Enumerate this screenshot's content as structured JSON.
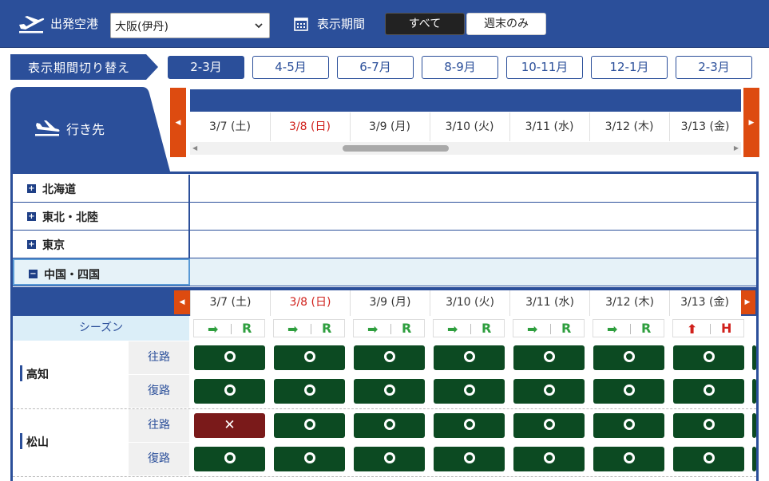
{
  "header": {
    "airport_label": "出発空港",
    "airport_value": "大阪(伊丹)",
    "period_label": "表示期間",
    "toggle_all": "すべて",
    "toggle_weekend": "週末のみ"
  },
  "period_switch": {
    "label": "表示期間切り替え",
    "tabs": [
      "2-3月",
      "4-5月",
      "6-7月",
      "8-9月",
      "10-11月",
      "12-1月",
      "2-3月"
    ],
    "active_index": 0
  },
  "destination": {
    "label": "行き先"
  },
  "dates": [
    {
      "label": "3/7 (土)",
      "sunday": false
    },
    {
      "label": "3/8 (日)",
      "sunday": true
    },
    {
      "label": "3/9 (月)",
      "sunday": false
    },
    {
      "label": "3/10 (火)",
      "sunday": false
    },
    {
      "label": "3/11 (水)",
      "sunday": false
    },
    {
      "label": "3/12 (木)",
      "sunday": false
    },
    {
      "label": "3/13 (金)",
      "sunday": false
    }
  ],
  "regions": [
    {
      "name": "北海道",
      "expanded": false
    },
    {
      "name": "東北・北陸",
      "expanded": false
    },
    {
      "name": "東京",
      "expanded": false
    },
    {
      "name": "中国・四国",
      "expanded": true
    }
  ],
  "season": {
    "label": "シーズン",
    "badges": [
      {
        "arrow": "➡",
        "code": "R",
        "color": "green"
      },
      {
        "arrow": "➡",
        "code": "R",
        "color": "green"
      },
      {
        "arrow": "➡",
        "code": "R",
        "color": "green"
      },
      {
        "arrow": "➡",
        "code": "R",
        "color": "green"
      },
      {
        "arrow": "➡",
        "code": "R",
        "color": "green"
      },
      {
        "arrow": "➡",
        "code": "R",
        "color": "green"
      },
      {
        "arrow": "⬆",
        "code": "H",
        "color": "red"
      }
    ]
  },
  "cities": [
    {
      "name": "高知",
      "rows": [
        {
          "direction": "往路",
          "seats": [
            "○",
            "○",
            "○",
            "○",
            "○",
            "○",
            "○"
          ]
        },
        {
          "direction": "復路",
          "seats": [
            "○",
            "○",
            "○",
            "○",
            "○",
            "○",
            "○"
          ]
        }
      ]
    },
    {
      "name": "松山",
      "rows": [
        {
          "direction": "往路",
          "seats": [
            "✕",
            "○",
            "○",
            "○",
            "○",
            "○",
            "○"
          ]
        },
        {
          "direction": "復路",
          "seats": [
            "○",
            "○",
            "○",
            "○",
            "○",
            "○",
            "○"
          ]
        }
      ]
    }
  ],
  "colors": {
    "brand": "#2b4f9a",
    "nav_orange": "#dd4b10",
    "available": "#0c4a22",
    "full": "#7a1a1a",
    "sunday": "#d0201b"
  }
}
